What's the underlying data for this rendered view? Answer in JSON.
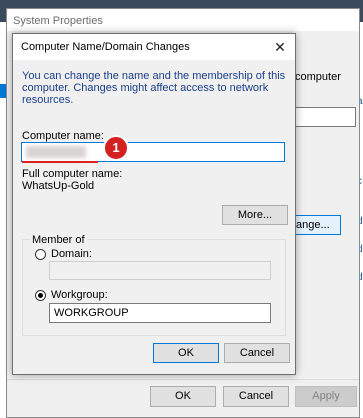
{
  "background_window": {
    "title": "System Properties",
    "computer_fragment_1": "computer",
    "computer_fragment_2": "",
    "change_button_fragment": "ange...",
    "ok_label": "OK",
    "cancel_label": "Cancel",
    "apply_label": "Apply"
  },
  "dialog": {
    "title": "Computer Name/Domain Changes",
    "description_line1": "You can change the name and the membership of this",
    "description_line2": "computer. Changes might affect access to network resources.",
    "computer_name_label": "Computer name:",
    "computer_name_value": "",
    "full_name_label": "Full computer name:",
    "full_name_value": "WhatsUp-Gold",
    "more_label": "More...",
    "member_of_label": "Member of",
    "domain_label": "Domain:",
    "domain_value": "",
    "workgroup_label": "Workgroup:",
    "workgroup_value": "WORKGROUP",
    "selected_membership": "workgroup",
    "ok_label": "OK",
    "cancel_label": "Cancel"
  },
  "annotation": {
    "step_number": "1",
    "color": "#d32020"
  },
  "colors": {
    "accent": "#0078d7",
    "description_text": "#1a3f8a"
  },
  "edge_fragments": [
    "a",
    "c",
    "d",
    "d",
    "d",
    "f",
    "f"
  ]
}
